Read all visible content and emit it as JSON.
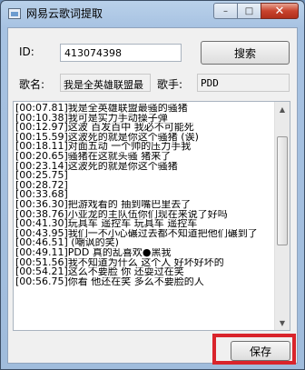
{
  "window": {
    "title": "网易云歌词提取",
    "minimize": "–",
    "maximize": "□",
    "close": "✕"
  },
  "form": {
    "id_label": "ID:",
    "id_value": "413074398",
    "search_label": "搜索",
    "song_label": "歌名:",
    "song_value": "我是全英雄联盟最",
    "singer_label": "歌手:",
    "singer_value": "PDD"
  },
  "lyrics": [
    "[00:07.81]我是全英雄联盟最骚的骚猪",
    "[00:10.38]我可是实力手动操子弹",
    "[00:12.97]这波  百发百中  我必不可能死",
    "[00:15.59]这波死的就是你这个骚猪 (诶)",
    "[00:18.11]对面五动 一个帅的压力手我",
    "[00:20.65]骚猪在这就头骚 猪来了",
    "[00:23.14]这波死的就是你这个骚猪",
    "[00:25.75]",
    "[00:28.72]",
    "[00:33.68]",
    "[00:36.30]把游戏看的  抽到嘴巴里去了",
    "[00:38.76]小亚龙的主队伍你们现在来说了好吗",
    "[00:41.30]玩具车 遥控车 玩具车 遥控车",
    "[00:43.95]我们一不小心碾过去都不知道把他们碾到了",
    "[00:46.51] (嘲讽的笑)",
    "[00:49.11]PDD 真的乱喜欢●黑我",
    "[00:51.56]我不知道为什么 这个人 好坏好坏的",
    "[00:54.21]这么不要脸 你 还耍过在笑",
    "[00:56.75]你看 他还在笑 多么不要脸的人"
  ],
  "footer": {
    "save_label": "保存"
  },
  "colors": {
    "highlight": "#d9242b",
    "titlebar": "#b9d1ea",
    "close_button": "#c8432d"
  }
}
